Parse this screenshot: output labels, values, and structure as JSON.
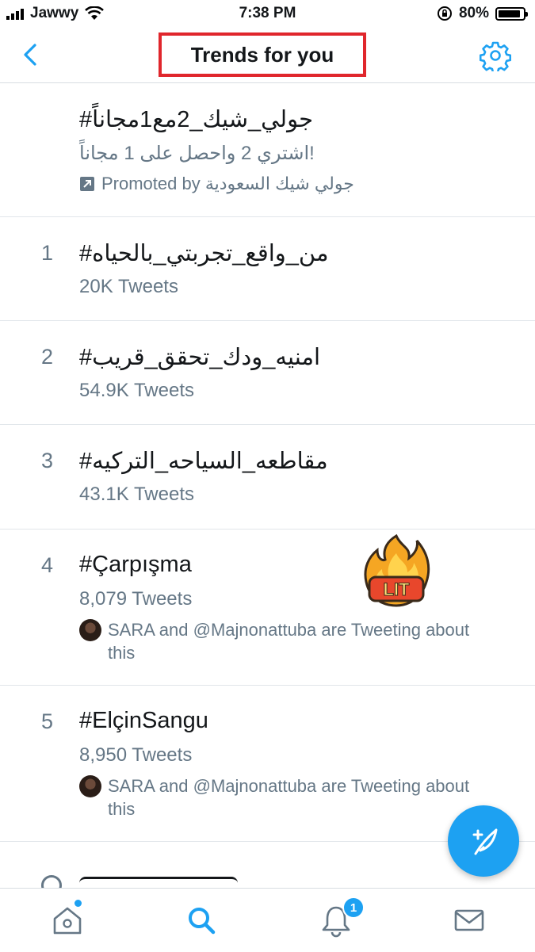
{
  "status": {
    "carrier": "Jawwy",
    "time": "7:38 PM",
    "battery": "80%",
    "battery_level": 0.8
  },
  "header": {
    "title": "Trends for you"
  },
  "promoted": {
    "hashtag": "#جولي_شيك_2مع1مجاناً",
    "description": "اشتري 2 واحصل على 1 مجاناً!",
    "promoted_label": "Promoted by جولي شيك السعودية"
  },
  "trends": [
    {
      "rank": "1",
      "hashtag": "#من_واقع_تجربتي_بالحياه",
      "count": "20K Tweets"
    },
    {
      "rank": "2",
      "hashtag": "#امنيه_ودك_تحقق_قريب",
      "count": "54.9K Tweets"
    },
    {
      "rank": "3",
      "hashtag": "#مقاطعه_السياحه_التركيه",
      "count": "43.1K Tweets"
    },
    {
      "rank": "4",
      "hashtag": "#Çarpışma",
      "count": "8,079 Tweets",
      "context": "SARA and @Majnonattuba are Tweeting about this"
    },
    {
      "rank": "5",
      "hashtag": "#ElçinSangu",
      "count": "8,950 Tweets",
      "context": "SARA and @Majnonattuba are Tweeting about this"
    }
  ],
  "sticker": {
    "text": "LIT",
    "icon": "fire-icon"
  },
  "tabbar": {
    "notifications_badge": "1"
  },
  "colors": {
    "accent": "#1da1f2",
    "highlight_box": "#e0262c",
    "secondary_text": "#657786"
  }
}
